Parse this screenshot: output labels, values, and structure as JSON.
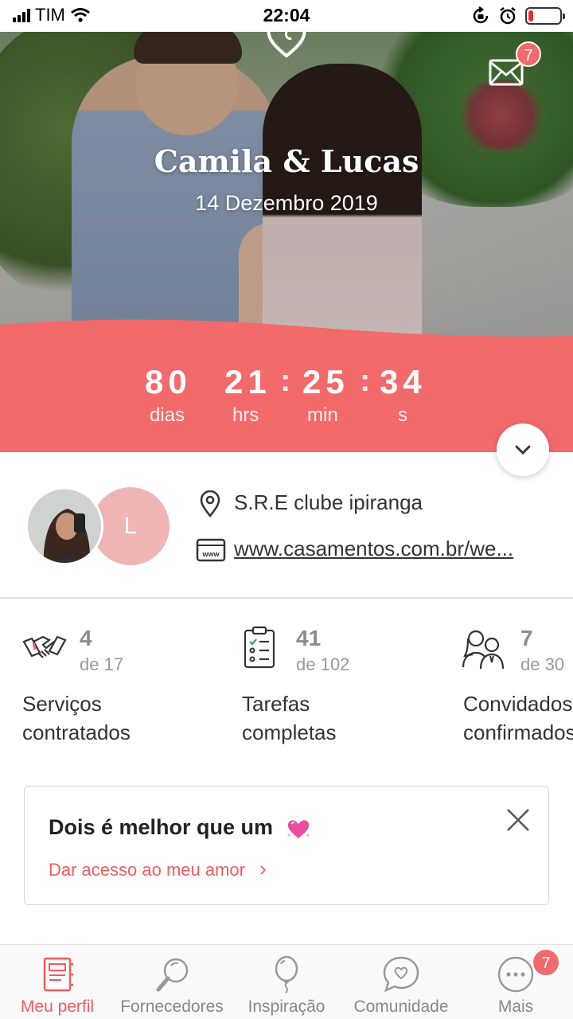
{
  "status_bar": {
    "carrier": "TIM",
    "time": "22:04",
    "battery_percent": 15,
    "icons": [
      "signal-icon",
      "wifi-icon",
      "rotation-lock-icon",
      "alarm-icon",
      "battery-icon"
    ]
  },
  "hero": {
    "couple_name": "Camila & Lucas",
    "date": "14 Dezembro 2019",
    "message_badge": "7",
    "countdown": [
      {
        "value": "80",
        "unit": "dias"
      },
      {
        "value": "21",
        "unit": "hrs"
      },
      {
        "value": "25",
        "unit": "min"
      },
      {
        "value": "34",
        "unit": "s"
      }
    ],
    "separator": ":"
  },
  "profile": {
    "partner_initial": "L",
    "location": "S.R.E clube ipiranga",
    "website": "www.casamentos.com.br/we..."
  },
  "stats": [
    {
      "icon": "handshake-icon",
      "value": "4",
      "total": "de 17",
      "label_line1": "Serviços",
      "label_line2": "contratados"
    },
    {
      "icon": "checklist-icon",
      "value": "41",
      "total": "de 102",
      "label_line1": "Tarefas",
      "label_line2": "completas"
    },
    {
      "icon": "guests-icon",
      "value": "7",
      "total": "de 30",
      "label_line1": "Convidados",
      "label_line2": "confirmados"
    }
  ],
  "invite_card": {
    "title": "Dois é melhor que um",
    "link": "Dar acesso ao meu amor",
    "link_arrow": "›"
  },
  "bottom_nav": [
    {
      "label": "Meu perfil",
      "icon": "notebook-icon",
      "active": true
    },
    {
      "label": "Fornecedores",
      "icon": "magnifier-icon",
      "active": false
    },
    {
      "label": "Inspiração",
      "icon": "balloon-icon",
      "active": false
    },
    {
      "label": "Comunidade",
      "icon": "chat-heart-icon",
      "active": false
    },
    {
      "label": "Mais",
      "icon": "more-icon",
      "active": false
    }
  ],
  "more_badge": "7",
  "colors": {
    "accent": "#f36a6b",
    "link": "#f05c5e",
    "avatar_letter_bg": "#efb5b5",
    "battery_low": "#e8302d"
  }
}
